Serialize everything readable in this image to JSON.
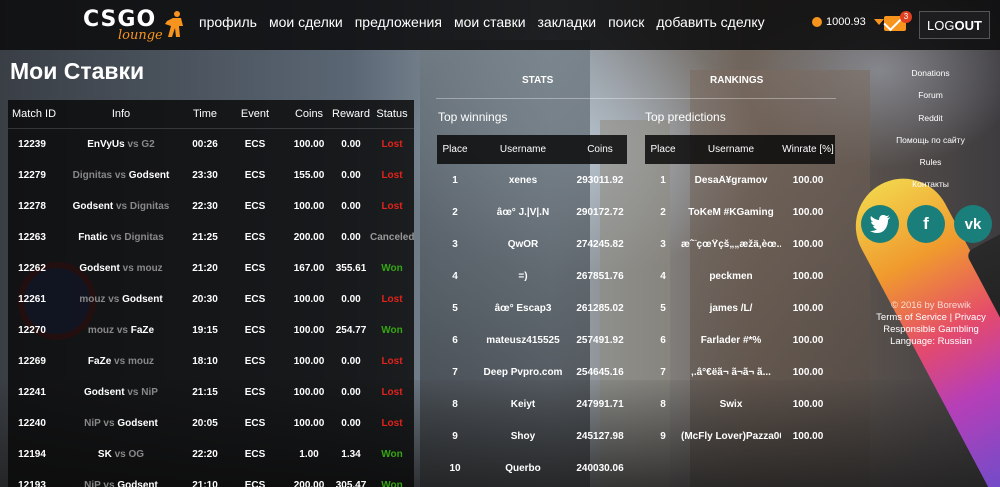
{
  "header": {
    "logo_text": "CSGO",
    "logo_sub": "lounge",
    "nav": [
      "профиль",
      "мои сделки",
      "предложения",
      "мои ставки",
      "закладки",
      "поиск",
      "добавить сделку"
    ],
    "balance": "1000.93",
    "mail_count": "3",
    "logout_prefix": "LOG",
    "logout_suffix": "OUT"
  },
  "page_title": "Мои Ставки",
  "bets": {
    "columns": [
      "Match ID",
      "Info",
      "Time",
      "Event",
      "Coins",
      "Reward",
      "Status"
    ],
    "rows": [
      {
        "id": "12239",
        "team_a": "EnVyUs",
        "vs": "vs",
        "team_b": "G2",
        "win": "a",
        "time": "00:26",
        "event": "ECS",
        "coins": "100.00",
        "reward": "0.00",
        "status": "Lost"
      },
      {
        "id": "12279",
        "team_a": "Dignitas",
        "vs": "vs",
        "team_b": "Godsent",
        "win": "b",
        "time": "23:30",
        "event": "ECS",
        "coins": "155.00",
        "reward": "0.00",
        "status": "Lost"
      },
      {
        "id": "12278",
        "team_a": "Godsent",
        "vs": "vs",
        "team_b": "Dignitas",
        "win": "a",
        "time": "22:30",
        "event": "ECS",
        "coins": "100.00",
        "reward": "0.00",
        "status": "Lost"
      },
      {
        "id": "12263",
        "team_a": "Fnatic",
        "vs": "vs",
        "team_b": "Dignitas",
        "win": "a",
        "time": "21:25",
        "event": "ECS",
        "coins": "200.00",
        "reward": "0.00",
        "status": "Canceled"
      },
      {
        "id": "12262",
        "team_a": "Godsent",
        "vs": "vs",
        "team_b": "mouz",
        "win": "a",
        "time": "21:20",
        "event": "ECS",
        "coins": "167.00",
        "reward": "355.61",
        "status": "Won"
      },
      {
        "id": "12261",
        "team_a": "mouz",
        "vs": "vs",
        "team_b": "Godsent",
        "win": "b",
        "time": "20:30",
        "event": "ECS",
        "coins": "100.00",
        "reward": "0.00",
        "status": "Lost"
      },
      {
        "id": "12270",
        "team_a": "mouz",
        "vs": "vs",
        "team_b": "FaZe",
        "win": "b",
        "time": "19:15",
        "event": "ECS",
        "coins": "100.00",
        "reward": "254.77",
        "status": "Won"
      },
      {
        "id": "12269",
        "team_a": "FaZe",
        "vs": "vs",
        "team_b": "mouz",
        "win": "a",
        "time": "18:10",
        "event": "ECS",
        "coins": "100.00",
        "reward": "0.00",
        "status": "Lost"
      },
      {
        "id": "12241",
        "team_a": "Godsent",
        "vs": "vs",
        "team_b": "NiP",
        "win": "a",
        "time": "21:15",
        "event": "ECS",
        "coins": "100.00",
        "reward": "0.00",
        "status": "Lost"
      },
      {
        "id": "12240",
        "team_a": "NiP",
        "vs": "vs",
        "team_b": "Godsent",
        "win": "b",
        "time": "20:05",
        "event": "ECS",
        "coins": "100.00",
        "reward": "0.00",
        "status": "Lost"
      },
      {
        "id": "12194",
        "team_a": "SK",
        "vs": "vs",
        "team_b": "OG",
        "win": "a",
        "time": "22:20",
        "event": "ECS",
        "coins": "1.00",
        "reward": "1.34",
        "status": "Won"
      },
      {
        "id": "12193",
        "team_a": "NiP",
        "vs": "vs",
        "team_b": "Godsent",
        "win": "b",
        "time": "21:10",
        "event": "ECS",
        "coins": "200.00",
        "reward": "305.47",
        "status": "Won"
      }
    ]
  },
  "tabs": {
    "stats": "STATS",
    "rankings": "RANKINGS"
  },
  "top_winnings": {
    "title": "Top winnings",
    "columns": [
      "Place",
      "Username",
      "Coins"
    ],
    "rows": [
      {
        "place": "1",
        "user": "xenes",
        "val": "293011.92"
      },
      {
        "place": "2",
        "user": "âœ° J.|V|.N",
        "val": "290172.72"
      },
      {
        "place": "3",
        "user": "QwOR",
        "val": "274245.82"
      },
      {
        "place": "4",
        "user": "=)",
        "val": "267851.76"
      },
      {
        "place": "5",
        "user": "âœ° Escap3",
        "val": "261285.02"
      },
      {
        "place": "6",
        "user": "mateusz415525",
        "val": "257491.92"
      },
      {
        "place": "7",
        "user": "Deep Pvpro.com",
        "val": "254645.16"
      },
      {
        "place": "8",
        "user": "Keiyt",
        "val": "247991.71"
      },
      {
        "place": "9",
        "user": "Shoy",
        "val": "245127.98"
      },
      {
        "place": "10",
        "user": "Querbo",
        "val": "240030.06"
      }
    ]
  },
  "top_predictions": {
    "title": "Top predictions",
    "columns": [
      "Place",
      "Username",
      "Winrate [%]"
    ],
    "rows": [
      {
        "place": "1",
        "user": "DesaÂ¥gramov",
        "val": "100.00"
      },
      {
        "place": "2",
        "user": "ToKeM #KGaming",
        "val": "100.00"
      },
      {
        "place": "3",
        "user": "æˆ¨çœŸçš„„æžä,èœ...",
        "val": "100.00"
      },
      {
        "place": "4",
        "user": "peckmen",
        "val": "100.00"
      },
      {
        "place": "5",
        "user": "james /L/",
        "val": "100.00"
      },
      {
        "place": "6",
        "user": "Farlader #*%",
        "val": "100.00"
      },
      {
        "place": "7",
        "user": ",.â°€ëã¬ ã¬ã¬ ã...",
        "val": "100.00"
      },
      {
        "place": "8",
        "user": "Swix",
        "val": "100.00"
      },
      {
        "place": "9",
        "user": "(McFly Lover)Pazza00",
        "val": "100.00"
      }
    ]
  },
  "right_links": [
    "Donations",
    "Forum",
    "Reddit",
    "Помощь по сайту",
    "Rules",
    "Контакты"
  ],
  "social": {
    "twitter": "t",
    "facebook": "f",
    "vk": "vk"
  },
  "footer": {
    "copyright": "© 2016 by Borewik",
    "terms": "Terms of Service",
    "sep": "|",
    "privacy": "Privacy",
    "responsible": "Responsible Gambling",
    "language": "Language: Russian"
  },
  "colors": {
    "accent": "#f7941d",
    "lost": "#e2231a",
    "won": "#35a512",
    "social": "#1a7f7a"
  }
}
